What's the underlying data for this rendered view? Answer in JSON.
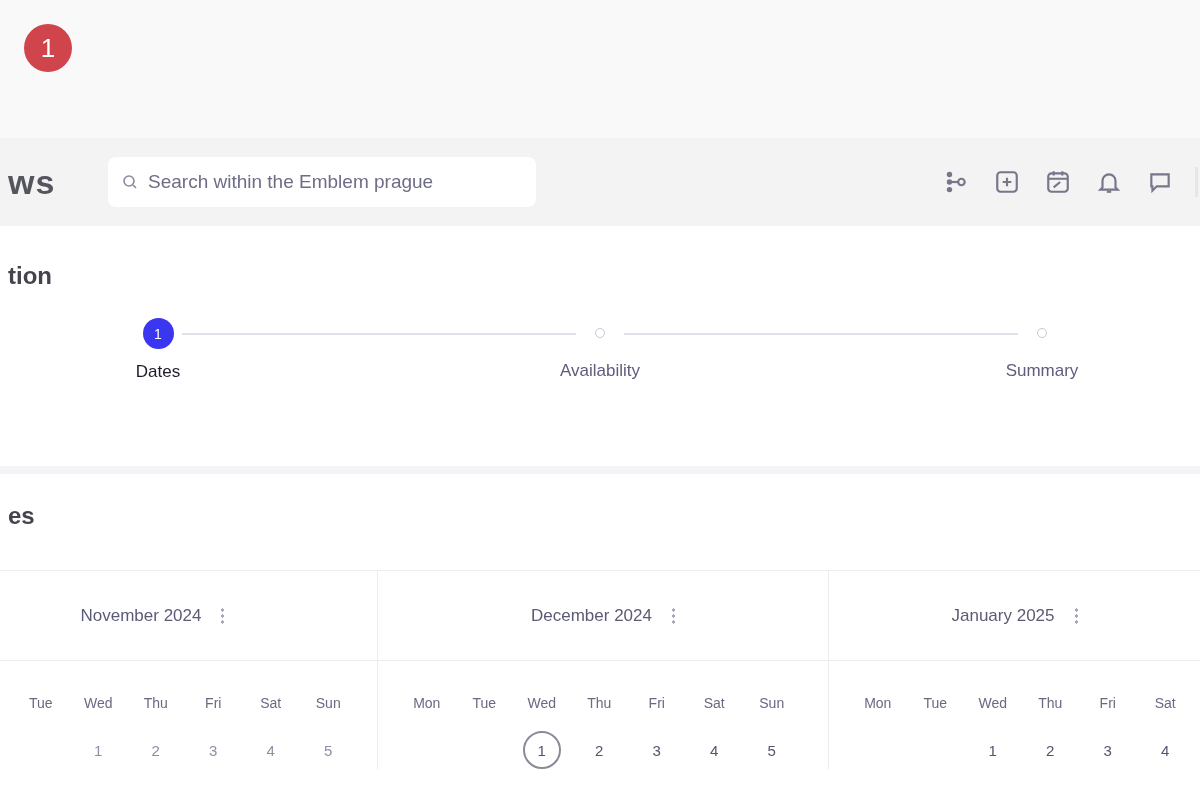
{
  "annotation_badge": {
    "label": "1"
  },
  "header": {
    "logo": "ws",
    "search": {
      "placeholder": "Search within the Emblem prague"
    }
  },
  "section_title": "tion",
  "stepper": [
    {
      "label": "Dates",
      "number": "1",
      "selected": true
    },
    {
      "label": "Availability",
      "selected": false
    },
    {
      "label": "Summary",
      "selected": false
    }
  ],
  "calendar_title": "es",
  "months": [
    {
      "title": "November 2024",
      "weekdays": [
        "Tue",
        "Wed",
        "Thu",
        "Fri",
        "Sat",
        "Sun"
      ],
      "days": [
        {
          "kind": "blank"
        },
        {
          "kind": "day",
          "label": "1",
          "disabled": true,
          "today": false
        },
        {
          "kind": "day",
          "label": "2",
          "disabled": true,
          "today": false
        },
        {
          "kind": "day",
          "label": "3",
          "disabled": true,
          "today": false
        },
        {
          "kind": "day",
          "label": "4",
          "disabled": true,
          "today": false
        },
        {
          "kind": "day",
          "label": "5",
          "disabled": true,
          "today": false
        }
      ]
    },
    {
      "title": "December 2024",
      "weekdays": [
        "Mon",
        "Tue",
        "Wed",
        "Thu",
        "Fri",
        "Sat",
        "Sun"
      ],
      "days": [
        {
          "kind": "blank"
        },
        {
          "kind": "blank"
        },
        {
          "kind": "day",
          "label": "1",
          "disabled": false,
          "today": true
        },
        {
          "kind": "day",
          "label": "2",
          "disabled": false,
          "today": false
        },
        {
          "kind": "day",
          "label": "3",
          "disabled": false,
          "today": false
        },
        {
          "kind": "day",
          "label": "4",
          "disabled": false,
          "today": false
        },
        {
          "kind": "day",
          "label": "5",
          "disabled": false,
          "today": false
        }
      ]
    },
    {
      "title": "January 2025",
      "weekdays": [
        "Mon",
        "Tue",
        "Wed",
        "Thu",
        "Fri",
        "Sat"
      ],
      "days": [
        {
          "kind": "blank"
        },
        {
          "kind": "blank"
        },
        {
          "kind": "day",
          "label": "1",
          "disabled": false,
          "today": false
        },
        {
          "kind": "day",
          "label": "2",
          "disabled": false,
          "today": false
        },
        {
          "kind": "day",
          "label": "3",
          "disabled": false,
          "today": false
        },
        {
          "kind": "day",
          "label": "4",
          "disabled": false,
          "today": false
        }
      ]
    }
  ]
}
